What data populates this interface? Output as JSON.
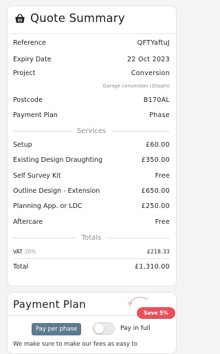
{
  "summary": {
    "title": "Quote Summary",
    "icon": "basket-icon",
    "rows": [
      {
        "label": "Reference",
        "value": "QFTYaftuJ"
      },
      {
        "label": "Expiry Date",
        "value": "22 Oct 2023"
      },
      {
        "label": "Project",
        "value": "Conversion",
        "note": "Garage conversion (20sqm)"
      },
      {
        "label": "Postcode",
        "value": "B170AL"
      },
      {
        "label": "Payment Plan",
        "value": "Phase"
      }
    ],
    "services_heading": "Services",
    "services": [
      {
        "label": "Setup",
        "value": "£60.00"
      },
      {
        "label": "Existing Design Draughting",
        "value": "£350.00"
      },
      {
        "label": "Self Survey Kit",
        "value": "Free"
      },
      {
        "label": "Outline Design - Extension",
        "value": "£650.00"
      },
      {
        "label": "Planning App. or LDC",
        "value": "£250.00"
      },
      {
        "label": "Aftercare",
        "value": "Free"
      }
    ],
    "totals_heading": "Totals",
    "vat": {
      "label": "VAT",
      "rate": "20%",
      "value": "£218.33"
    },
    "total": {
      "label": "Total",
      "value": "£1,310.00"
    }
  },
  "payment_plan": {
    "title": "Payment Plan",
    "save_badge": "Save 5%",
    "pay_per_phase": "Pay per phase",
    "pay_in_full": "Pay in full",
    "toggle_on": false,
    "description": "We make sure to make our fees as easy to"
  },
  "colors": {
    "accent_badge": "#e8505b",
    "phase_label": "#5d7a90"
  }
}
